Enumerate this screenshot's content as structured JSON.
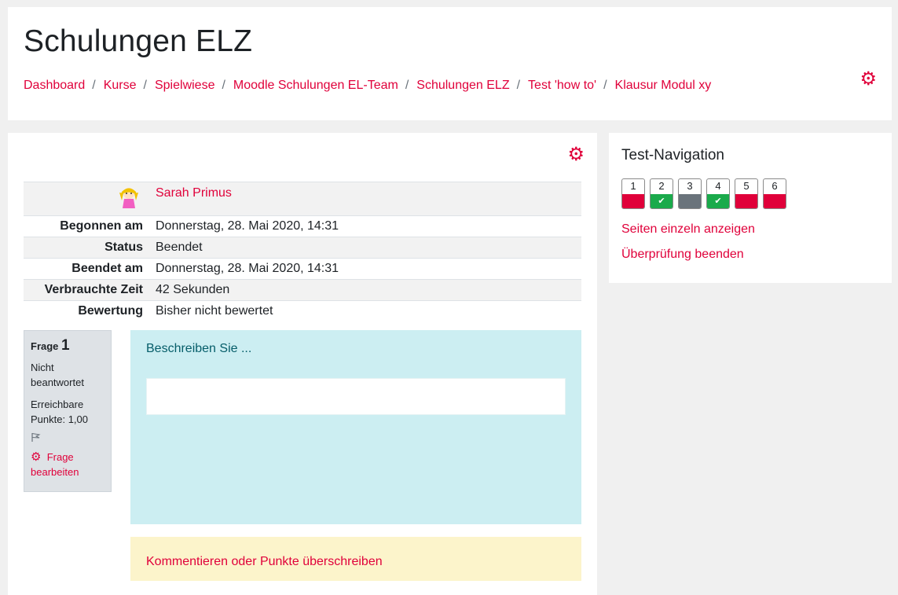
{
  "header": {
    "title": "Schulungen ELZ",
    "breadcrumb": [
      "Dashboard",
      "Kurse",
      "Spielwiese",
      "Moodle Schulungen EL-Team",
      "Schulungen ELZ",
      "Test 'how to'",
      "Klausur Modul xy"
    ]
  },
  "summary": {
    "user_name": "Sarah Primus",
    "rows": [
      {
        "label": "Begonnen am",
        "value": "Donnerstag, 28. Mai 2020, 14:31"
      },
      {
        "label": "Status",
        "value": "Beendet"
      },
      {
        "label": "Beendet am",
        "value": "Donnerstag, 28. Mai 2020, 14:31"
      },
      {
        "label": "Verbrauchte Zeit",
        "value": "42 Sekunden"
      },
      {
        "label": "Bewertung",
        "value": "Bisher nicht bewertet"
      }
    ]
  },
  "question": {
    "label": "Frage",
    "number": "1",
    "state": "Nicht beantwortet",
    "grade": "Erreichbare Punkte: 1,00",
    "edit_label": "Frage bearbeiten",
    "text": "Beschreiben Sie ...",
    "comment_link": "Kommentieren oder Punkte überschreiben"
  },
  "navigation": {
    "title": "Test-Navigation",
    "questions": [
      {
        "num": "1",
        "status": "incorrect",
        "color": "#e0003a"
      },
      {
        "num": "2",
        "status": "correct",
        "color": "#1aaa4b"
      },
      {
        "num": "3",
        "status": "notanswered",
        "color": "#6a737b"
      },
      {
        "num": "4",
        "status": "correct",
        "color": "#1aaa4b"
      },
      {
        "num": "5",
        "status": "incorrect",
        "color": "#e0003a"
      },
      {
        "num": "6",
        "status": "incorrect",
        "color": "#e0003a"
      }
    ],
    "show_one_page": "Seiten einzeln anzeigen",
    "finish_review": "Überprüfung beenden"
  },
  "colors": {
    "accent": "#e0003a",
    "info_bg": "#cceef2",
    "comment_bg": "#fcf4cb"
  }
}
